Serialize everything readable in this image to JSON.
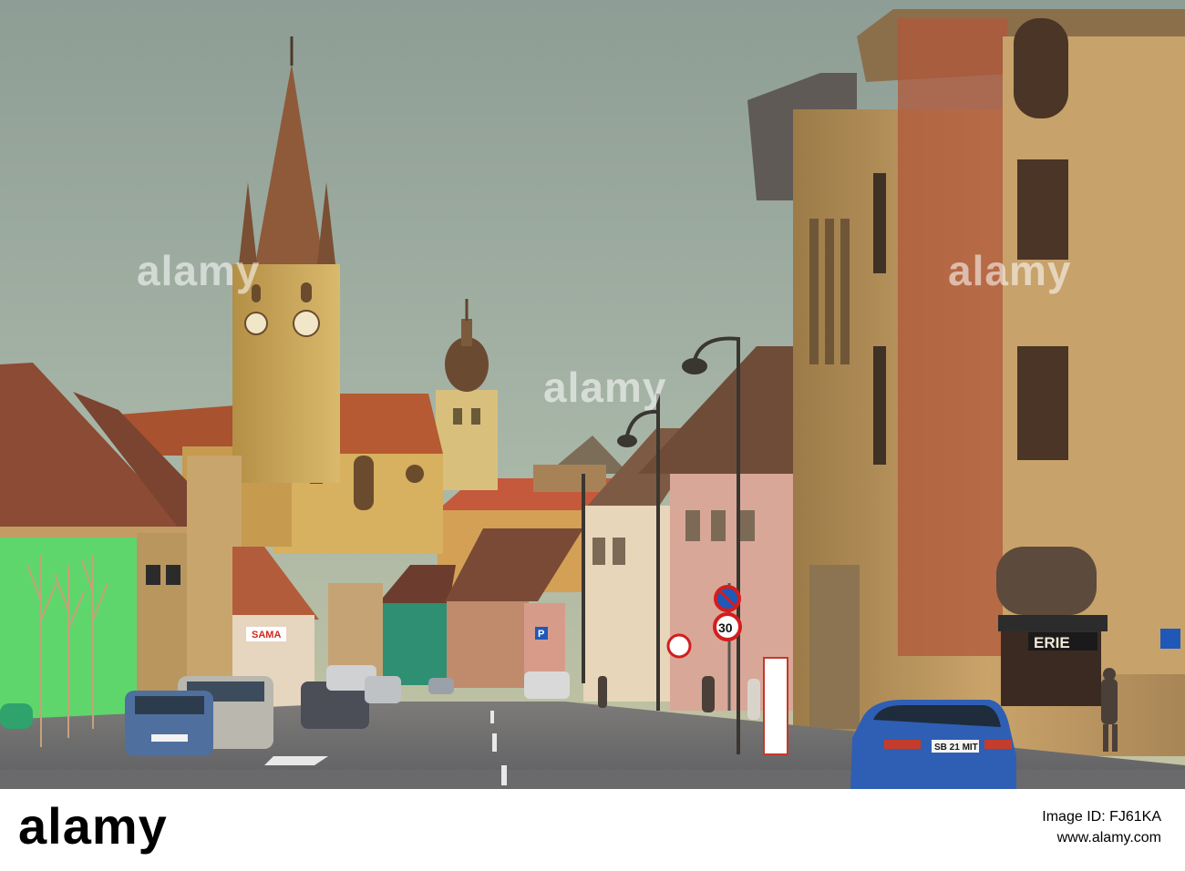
{
  "watermark": {
    "text": "alamy"
  },
  "footer": {
    "logo": "alamy",
    "image_id": "Image ID: FJ61KA",
    "site": "www.alamy.com"
  },
  "scene": {
    "shop_left": "SAMA",
    "shop_right": "ERIE",
    "speed_sign": "30",
    "plate_right": "SB 21 MIT",
    "parking_sign": "P"
  },
  "colors": {
    "sky": "#9fb0a4",
    "facade_right": "#b59462",
    "brick": "#b0573a",
    "tower": "#c9a75a",
    "green_house": "#5fd66b",
    "road": "#6f6f72",
    "car_blue": "#2e5fb4"
  }
}
